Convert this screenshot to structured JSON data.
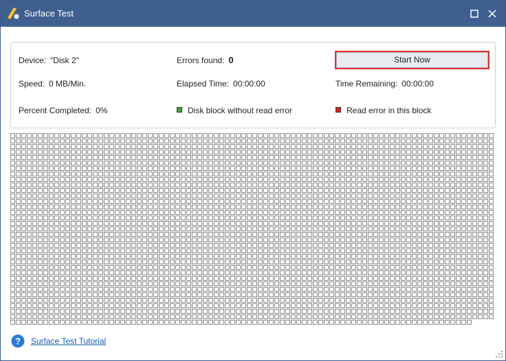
{
  "window": {
    "title": "Surface Test"
  },
  "status": {
    "device_label": "Device:",
    "device_value": "\"Disk 2\"",
    "errors_label": "Errors found:",
    "errors_value": "0",
    "speed_label": "Speed:",
    "speed_value": "0 MB/Min.",
    "elapsed_label": "Elapsed Time:",
    "elapsed_value": "00:00:00",
    "remaining_label": "Time Remaining:",
    "remaining_value": "00:00:00",
    "percent_label": "Percent Completed:",
    "percent_value": "0%"
  },
  "actions": {
    "start_label": "Start Now"
  },
  "legend": {
    "ok_label": "Disk block without read error",
    "ok_color": "#3aa635",
    "error_label": "Read error in this block",
    "error_color": "#d92020"
  },
  "footer": {
    "tutorial_link": "Surface Test Tutorial"
  },
  "colors": {
    "titlebar": "#3f5f91",
    "accent": "#2e7bd6",
    "button_highlight": "#e03030",
    "block_border": "#8c8c8c"
  },
  "icons": {
    "app": "surface-test-app-icon",
    "help": "help-icon",
    "maximize": "maximize-icon",
    "close": "close-icon"
  }
}
